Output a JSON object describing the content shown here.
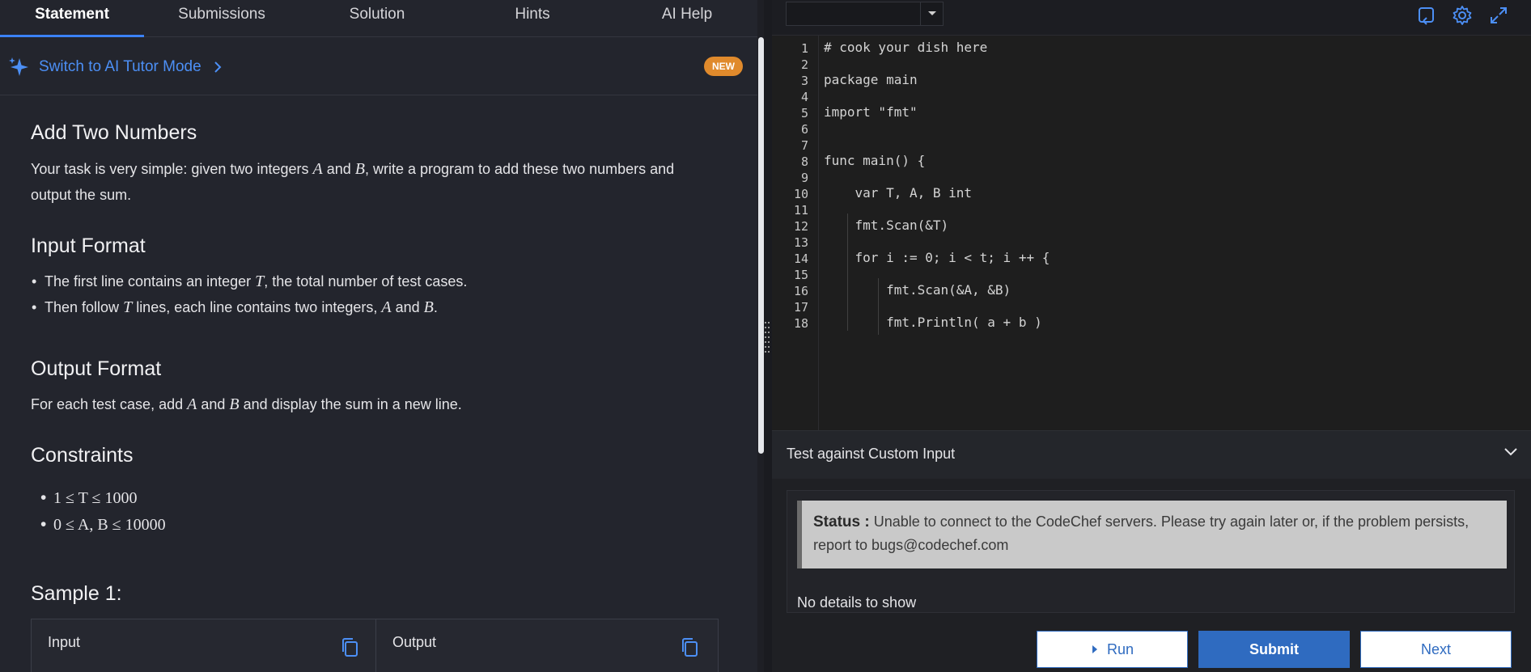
{
  "tabs": [
    {
      "label": "Statement",
      "active": true
    },
    {
      "label": "Submissions"
    },
    {
      "label": "Solution"
    },
    {
      "label": "Hints"
    },
    {
      "label": "AI Help"
    }
  ],
  "tutor": {
    "label": "Switch to AI Tutor Mode",
    "badge": "NEW"
  },
  "problem": {
    "title": "Add Two Numbers",
    "statement_pre": "Your task is very simple: given two integers ",
    "statement_a": "A",
    "statement_and": " and ",
    "statement_b": "B",
    "statement_post": ", write a program to add these two numbers and",
    "statement_line2": "output the sum.",
    "input_heading": "Input Format",
    "input_item1_pre": "The first line contains an integer ",
    "input_item1_var": "T",
    "input_item1_post": ", the total number of test cases.",
    "input_item2_pre": "Then follow ",
    "input_item2_var": "T",
    "input_item2_mid": " lines, each line contains two integers, ",
    "input_item2_a": "A",
    "input_item2_and": " and ",
    "input_item2_b": "B",
    "input_item2_end": ".",
    "output_heading": "Output Format",
    "output_pre": "For each test case, add ",
    "output_a": "A",
    "output_and": " and ",
    "output_b": "B",
    "output_post": " and display the sum in a new line.",
    "constraints_heading": "Constraints",
    "constraint1": "1 ≤ T ≤ 1000",
    "constraint2": "0 ≤ A, B ≤ 10000",
    "sample_heading": "Sample 1:",
    "sample_input_label": "Input",
    "sample_output_label": "Output"
  },
  "editor": {
    "line_numbers": [
      "1",
      "2",
      "3",
      "4",
      "5",
      "6",
      "7",
      "8",
      "9",
      "10",
      "11",
      "12",
      "13",
      "14",
      "15",
      "16",
      "17",
      "18"
    ],
    "lines": [
      "# cook your dish here",
      "",
      "package main",
      "",
      "import \"fmt\"",
      "",
      "",
      "func main() {",
      "",
      "    var T, A, B int",
      "",
      "    fmt.Scan(&T)",
      "",
      "    for i := 0; i < t; i ++ {",
      "",
      "        fmt.Scan(&A, &B)",
      "",
      "        fmt.Println( a + b )"
    ],
    "language": ""
  },
  "custom_input": {
    "label": "Test against Custom Input"
  },
  "status": {
    "label": "Status :",
    "message": "Unable to connect to the CodeChef servers. Please try again later or, if the problem persists, report to bugs@codechef.com"
  },
  "details": "No details to show",
  "buttons": {
    "run": "Run",
    "submit": "Submit",
    "next": "Next"
  },
  "icons": [
    "sparkle-icon",
    "chevron-right-icon",
    "copy-icon",
    "chevron-down-icon",
    "refresh-icon",
    "gear-icon",
    "expand-icon",
    "play-icon",
    "grip-icon"
  ],
  "colors": {
    "accent": "#2f6bc0",
    "link": "#4c8ff5",
    "badge": "#e08a2c",
    "tab_active": "#3b82f6"
  }
}
